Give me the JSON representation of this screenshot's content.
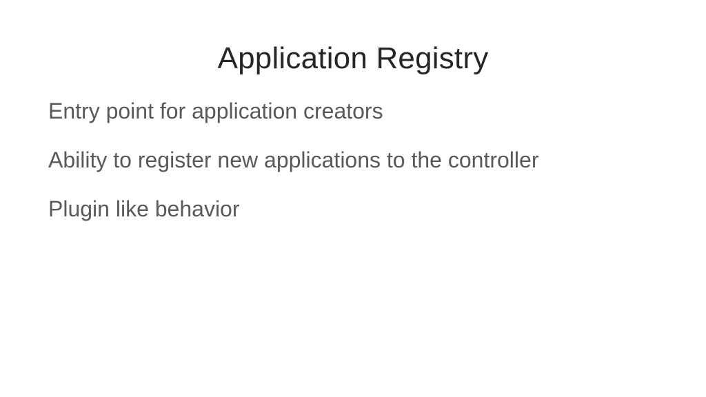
{
  "slide": {
    "title": "Application Registry",
    "bullets": [
      "Entry point for application creators",
      "Ability to register new applications to the controller",
      "Plugin like behavior"
    ]
  }
}
